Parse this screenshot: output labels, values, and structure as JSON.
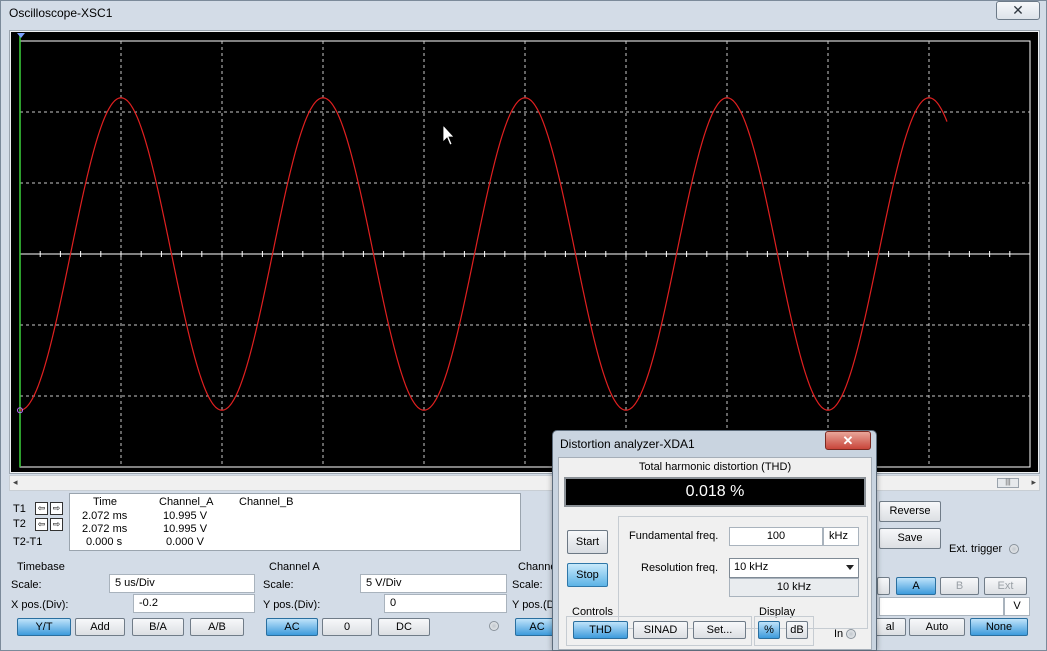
{
  "oscilloscope": {
    "title": "Oscilloscope-XSC1",
    "close_label": "✕",
    "waveform": {
      "color": "#e02020",
      "cycles_visible": 5,
      "peak_div": 2.2,
      "scale_y": "5 V/Div",
      "scale_t": "5 us/Div"
    },
    "scrollbar_thumb": "|||",
    "readout": {
      "headers": [
        "Time",
        "Channel_A",
        "Channel_B"
      ],
      "rows": [
        {
          "label": "T1",
          "time": "2.072 ms",
          "a": "10.995 V",
          "b": ""
        },
        {
          "label": "T2",
          "time": "2.072 ms",
          "a": "10.995 V",
          "b": ""
        },
        {
          "label": "T2-T1",
          "time": "0.000 s",
          "a": "0.000 V",
          "b": ""
        }
      ]
    },
    "timebase": {
      "title": "Timebase",
      "scale_label": "Scale:",
      "scale_value": "5 us/Div",
      "xpos_label": "X pos.(Div):",
      "xpos_value": "-0.2",
      "buttons": [
        "Y/T",
        "Add",
        "B/A",
        "A/B"
      ]
    },
    "channel_a": {
      "title": "Channel A",
      "scale_label": "Scale:",
      "scale_value": "5  V/Div",
      "ypos_label": "Y pos.(Div):",
      "ypos_value": "0",
      "buttons": [
        "AC",
        "0",
        "DC"
      ]
    },
    "channel_b": {
      "title": "Channe",
      "scale_label": "Scale:",
      "ypos_label": "Y pos.(Di",
      "button": "AC"
    },
    "right": {
      "reverse": "Reverse",
      "save": "Save",
      "ext_trigger": "Ext. trigger",
      "source_buttons": [
        "A",
        "B",
        "Ext"
      ],
      "unit": "V",
      "mode_partial": "al",
      "auto": "Auto",
      "none": "None"
    }
  },
  "distortion_analyzer": {
    "title": "Distortion analyzer-XDA1",
    "close_label": "✕",
    "thd_title": "Total harmonic distortion (THD)",
    "thd_value": "0.018 %",
    "start": "Start",
    "stop": "Stop",
    "fundamental_label": "Fundamental freq.",
    "fundamental_value": "100",
    "fundamental_unit": "kHz",
    "resolution_label": "Resolution freq.",
    "resolution_value": "10 kHz",
    "resolution_readout": "10 kHz",
    "controls_title": "Controls",
    "controls_buttons": [
      "THD",
      "SINAD",
      "Set..."
    ],
    "display_title": "Display",
    "display_buttons": [
      "%",
      "dB"
    ],
    "in_label": "In"
  }
}
